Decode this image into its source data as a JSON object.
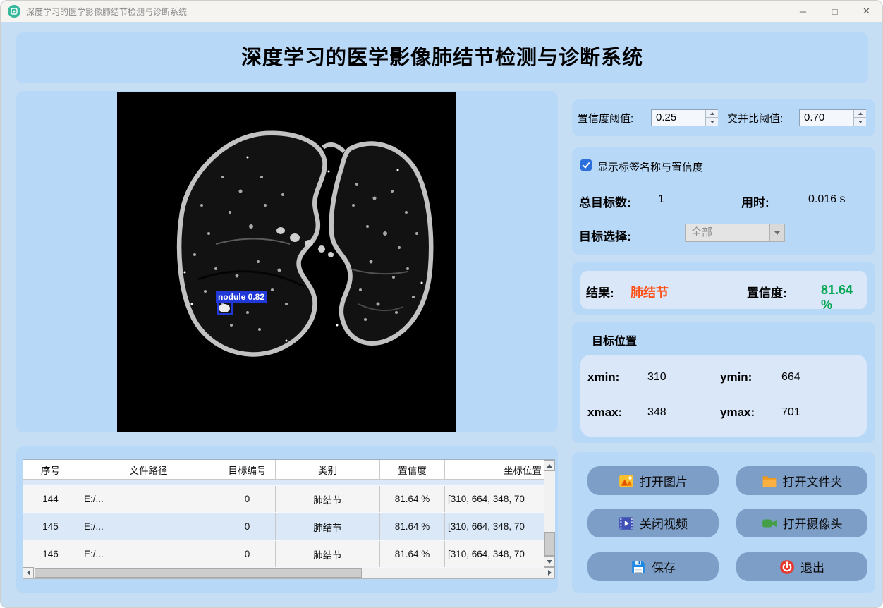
{
  "window": {
    "title": "深度学习的医学影像肺结节检测与诊断系统",
    "minimize_glyph": "─",
    "maximize_glyph": "□",
    "close_glyph": "✕"
  },
  "header": {
    "title": "深度学习的医学影像肺结节检测与诊断系统"
  },
  "viewer": {
    "detection_label": "nodule 0.82"
  },
  "thresholds": {
    "confidence_label": "置信度阈值:",
    "confidence_value": "0.25",
    "iou_label": "交并比阈值:",
    "iou_value": "0.70"
  },
  "options": {
    "show_labels_checkbox": "显示标签名称与置信度",
    "total_targets_label": "总目标数:",
    "total_targets_value": "1",
    "time_label": "用时:",
    "time_value": "0.016 s",
    "target_select_label": "目标选择:",
    "target_select_value": "全部"
  },
  "result": {
    "result_label": "结果:",
    "result_value": "肺结节",
    "confidence_label": "置信度:",
    "confidence_value": "81.64 %",
    "result_color": "#ff5117",
    "confidence_color": "#00a651"
  },
  "position": {
    "title": "目标位置",
    "xmin_label": "xmin:",
    "xmin_value": "310",
    "ymin_label": "ymin:",
    "ymin_value": "664",
    "xmax_label": "xmax:",
    "xmax_value": "348",
    "ymax_label": "ymax:",
    "ymax_value": "701"
  },
  "table": {
    "headers": [
      "序号",
      "文件路径",
      "目标编号",
      "类别",
      "置信度",
      "坐标位置"
    ],
    "rows": [
      [
        "144",
        "E:/...",
        "0",
        "肺结节",
        "81.64 %",
        "[310, 664, 348, 70"
      ],
      [
        "145",
        "E:/...",
        "0",
        "肺结节",
        "81.64 %",
        "[310, 664, 348, 70"
      ],
      [
        "146",
        "E:/...",
        "0",
        "肺结节",
        "81.64 %",
        "[310, 664, 348, 70"
      ]
    ]
  },
  "buttons": {
    "open_image": "打开图片",
    "open_folder": "打开文件夹",
    "close_video": "关闭视频",
    "open_camera": "打开摄像头",
    "save": "保存",
    "exit": "退出"
  },
  "colors": {
    "page_background": "#c5def4",
    "card_background": "#b7d8f7",
    "inner_card_background": "#d9e7f8",
    "button_background": "#7d9ec6",
    "detection_box": "#2038d8",
    "result_text": "#ff5117",
    "confidence_text": "#00a651"
  }
}
